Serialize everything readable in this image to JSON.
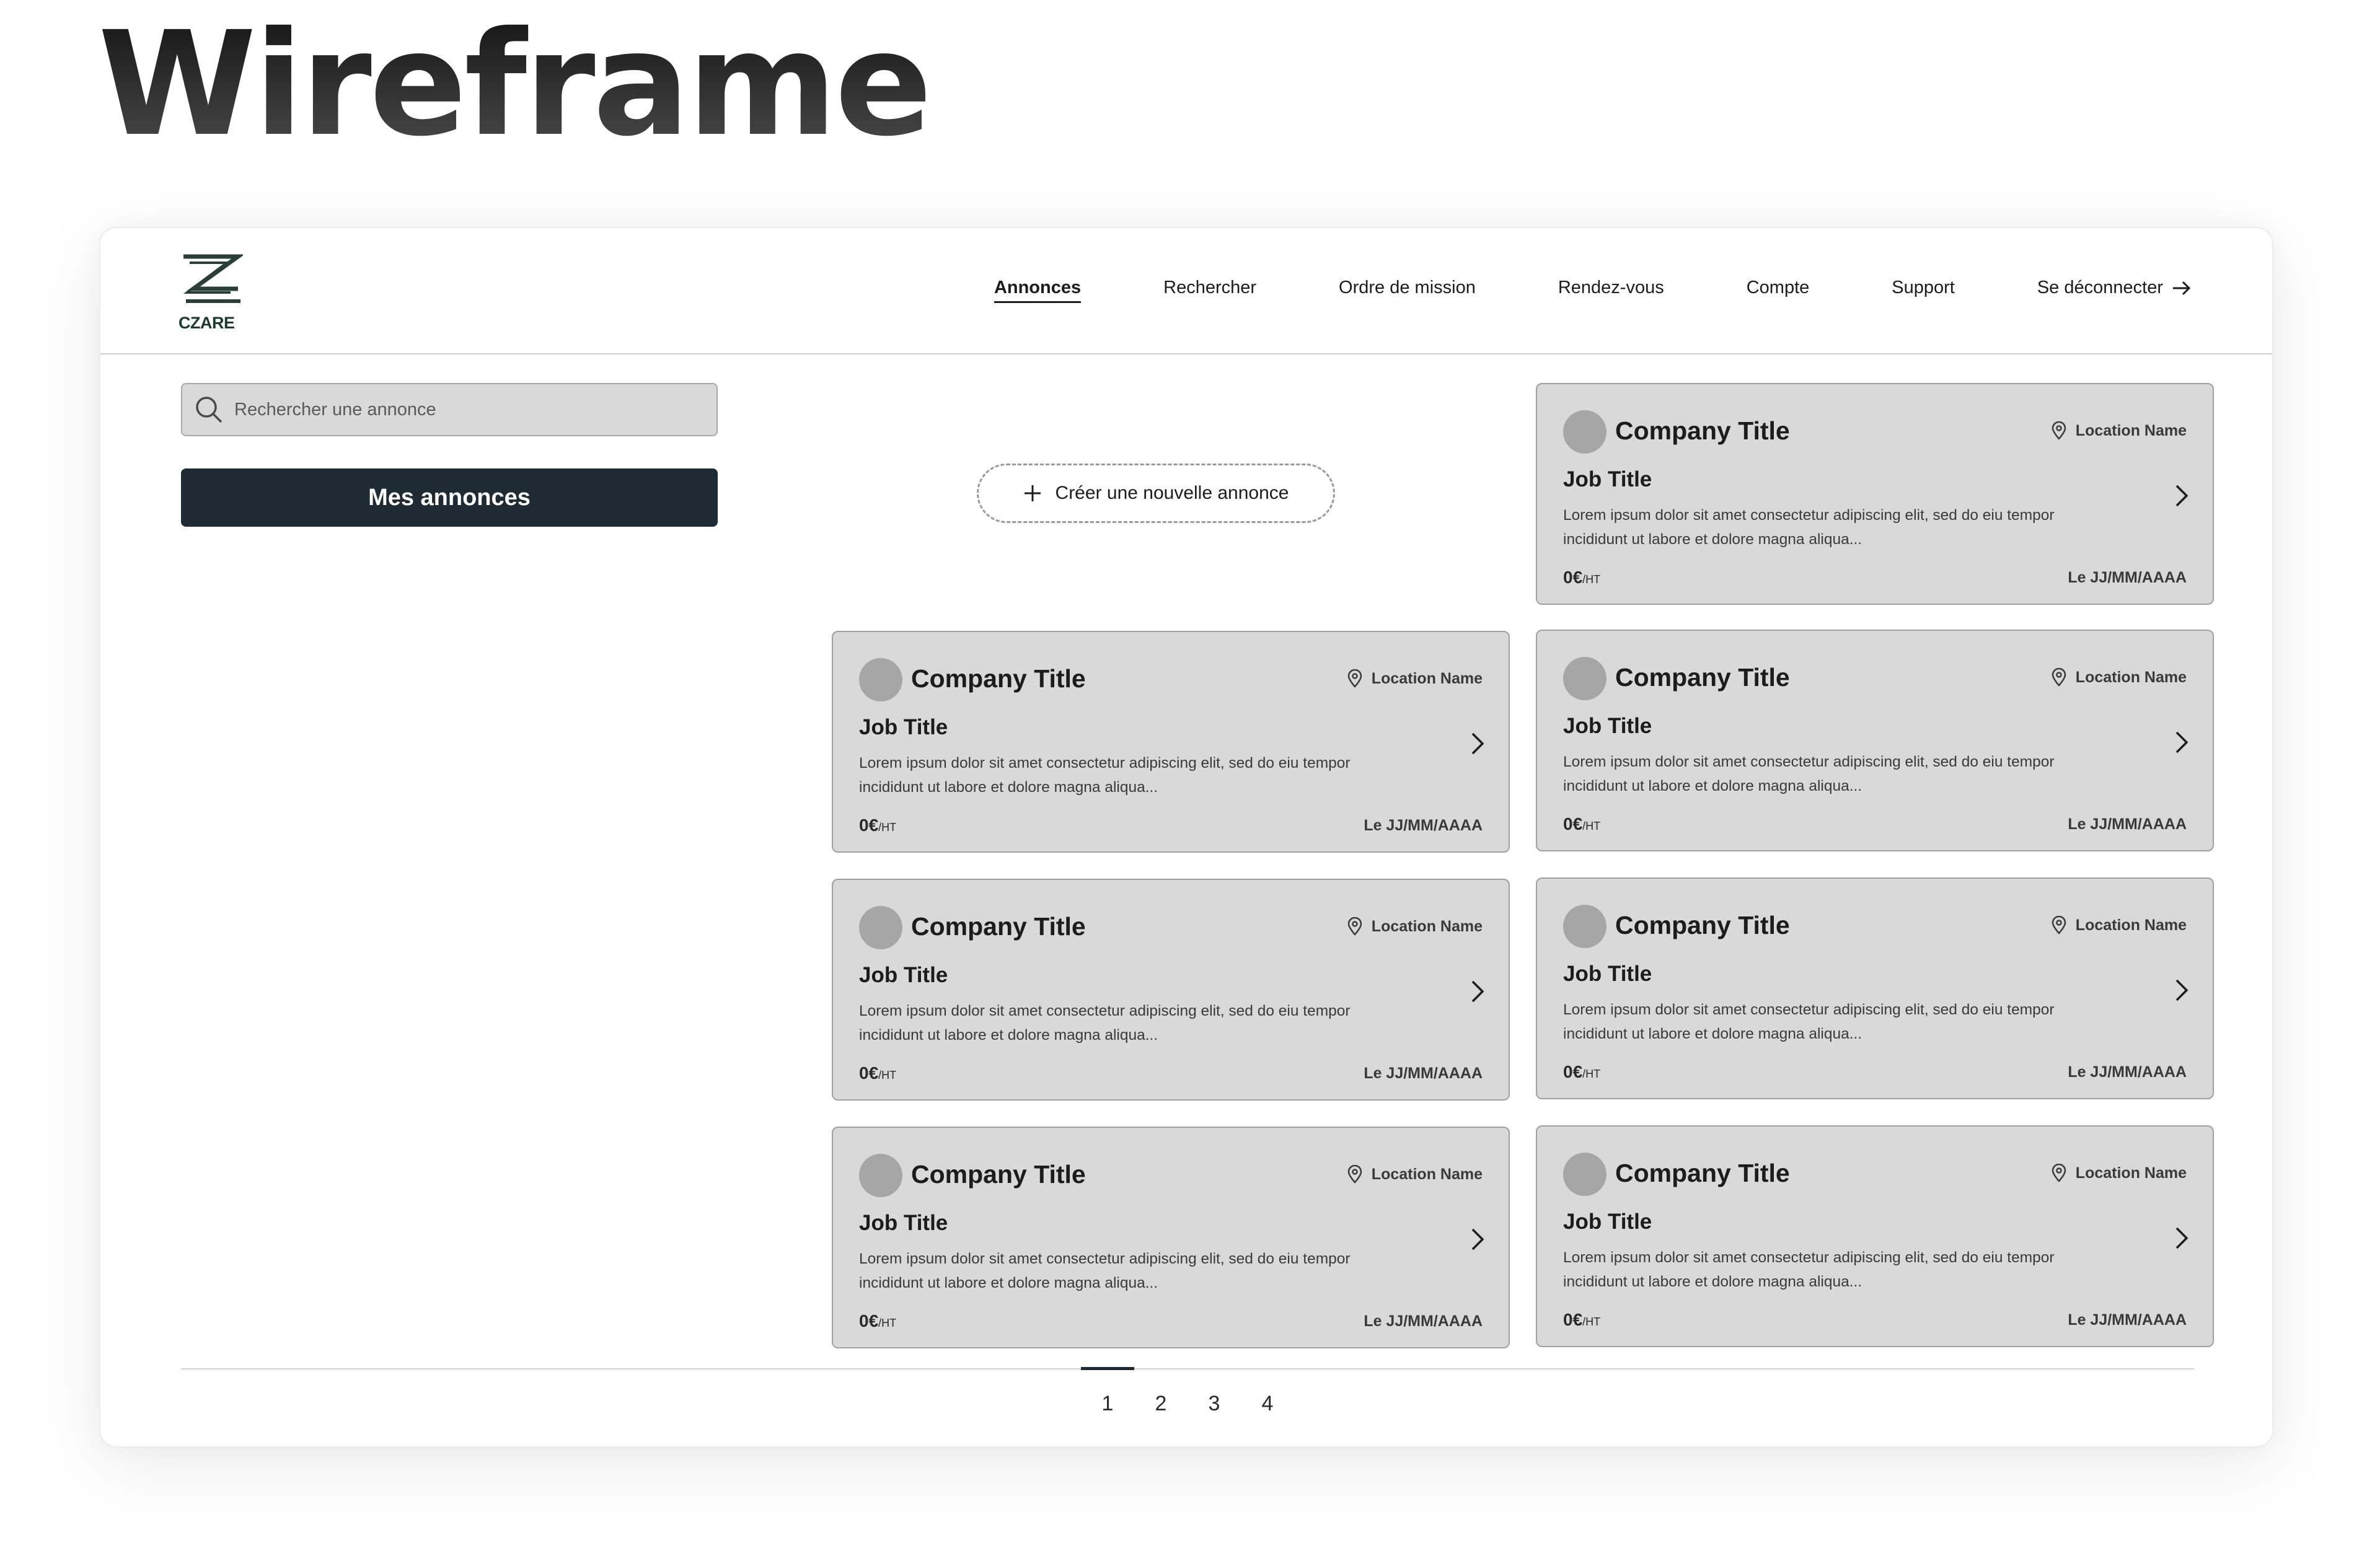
{
  "page_title": "Wireframe",
  "app": {
    "logo_text": "CZARE",
    "nav": [
      {
        "label": "Annonces"
      },
      {
        "label": "Rechercher"
      },
      {
        "label": "Ordre de mission"
      },
      {
        "label": "Rendez-vous"
      },
      {
        "label": "Compte"
      },
      {
        "label": "Support"
      },
      {
        "label": "Se déconnecter"
      }
    ],
    "active_nav": "Annonces"
  },
  "search": {
    "placeholder": "Rechercher une annonce"
  },
  "mes_annonces_label": "Mes annonces",
  "create_label": "Créer une nouvelle annonce",
  "cards": [
    {
      "company": "Company Title",
      "location": "Location Name",
      "job": "Job Title",
      "desc": "Lorem ipsum dolor sit amet consectetur adipiscing elit, sed do eiu tempor incididunt ut labore et dolore magna aliqua...",
      "price": "0€",
      "price_unit": "/HT",
      "date": "Le JJ/MM/AAAA"
    },
    {
      "company": "Company Title",
      "location": "Location Name",
      "job": "Job Title",
      "desc": "Lorem ipsum dolor sit amet consectetur adipiscing elit, sed do eiu tempor incididunt ut labore et dolore magna aliqua...",
      "price": "0€",
      "price_unit": "/HT",
      "date": "Le JJ/MM/AAAA"
    },
    {
      "company": "Company Title",
      "location": "Location Name",
      "job": "Job Title",
      "desc": "Lorem ipsum dolor sit amet consectetur adipiscing elit, sed do eiu tempor incididunt ut labore et dolore magna aliqua...",
      "price": "0€",
      "price_unit": "/HT",
      "date": "Le JJ/MM/AAAA"
    },
    {
      "company": "Company Title",
      "location": "Location Name",
      "job": "Job Title",
      "desc": "Lorem ipsum dolor sit amet consectetur adipiscing elit, sed do eiu tempor incididunt ut labore et dolore magna aliqua...",
      "price": "0€",
      "price_unit": "/HT",
      "date": "Le JJ/MM/AAAA"
    },
    {
      "company": "Company Title",
      "location": "Location Name",
      "job": "Job Title",
      "desc": "Lorem ipsum dolor sit amet consectetur adipiscing elit, sed do eiu tempor incididunt ut labore et dolore magna aliqua...",
      "price": "0€",
      "price_unit": "/HT",
      "date": "Le JJ/MM/AAAA"
    },
    {
      "company": "Company Title",
      "location": "Location Name",
      "job": "Job Title",
      "desc": "Lorem ipsum dolor sit amet consectetur adipiscing elit, sed do eiu tempor incididunt ut labore et dolore magna aliqua...",
      "price": "0€",
      "price_unit": "/HT",
      "date": "Le JJ/MM/AAAA"
    },
    {
      "company": "Company Title",
      "location": "Location Name",
      "job": "Job Title",
      "desc": "Lorem ipsum dolor sit amet consectetur adipiscing elit, sed do eiu tempor incididunt ut labore et dolore magna aliqua...",
      "price": "0€",
      "price_unit": "/HT",
      "date": "Le JJ/MM/AAAA"
    }
  ],
  "pagination": {
    "pages": [
      "1",
      "2",
      "3",
      "4"
    ],
    "current": "1"
  },
  "colors": {
    "primary": "#1e2b34",
    "card_bg": "#d9d9d9",
    "avatar": "#a6a6a6"
  }
}
